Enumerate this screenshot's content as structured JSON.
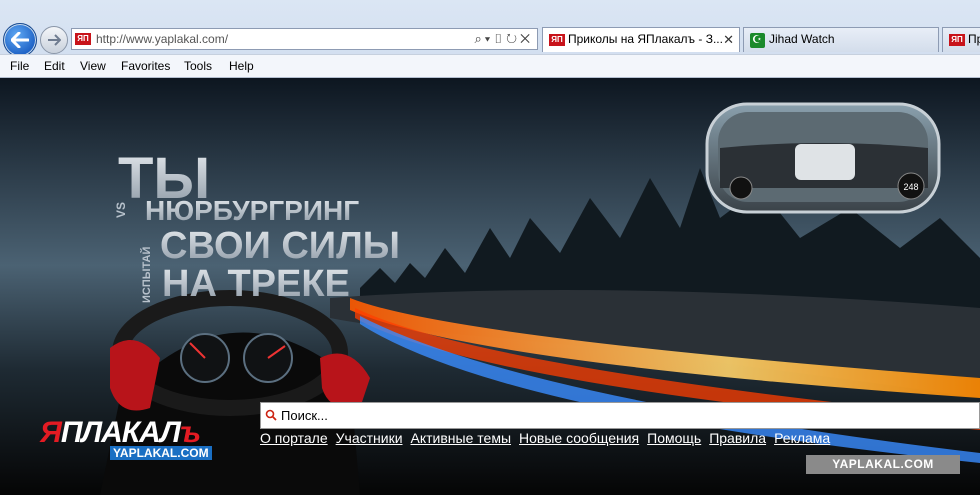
{
  "browser": {
    "address": {
      "url": "http://www.yaplakal.com/",
      "favicon_text": "ЯП"
    },
    "tabs": [
      {
        "label": "Приколы на ЯПлакалъ - З...",
        "icon": "ЯП",
        "close": "✕",
        "active": true
      },
      {
        "label": "Jihad Watch",
        "icon": "crescent-icon",
        "active": false
      },
      {
        "label": "Пр",
        "icon": "ЯП",
        "active": false
      }
    ],
    "menu": [
      "File",
      "Edit",
      "View",
      "Favorites",
      "Tools",
      "Help"
    ]
  },
  "page": {
    "banner": {
      "headline_line1": "ТЫ",
      "headline_vs": "VS",
      "headline_line2": "НЮРБУРГРИНГ",
      "headline_side": "ИСПЫТАЙ",
      "headline_line3": "СВОИ СИЛЫ",
      "headline_line4": "НА ТРЕКЕ",
      "speed_readout": "248"
    },
    "logo": {
      "main_red": "Я",
      "main_white": "ПЛАКАЛ",
      "sign": "ъ",
      "sub": "YAPLAKAL.COM"
    },
    "search": {
      "placeholder": "Поиск..."
    },
    "nav_links": [
      "О портале",
      "Участники",
      "Активные темы",
      "Новые сообщения",
      "Помощь",
      "Правила",
      "Реклама"
    ],
    "watermark": "YAPLAKAL.COM"
  },
  "colors": {
    "brand_red": "#e31b23",
    "chrome_blue": "#1f63c6"
  }
}
